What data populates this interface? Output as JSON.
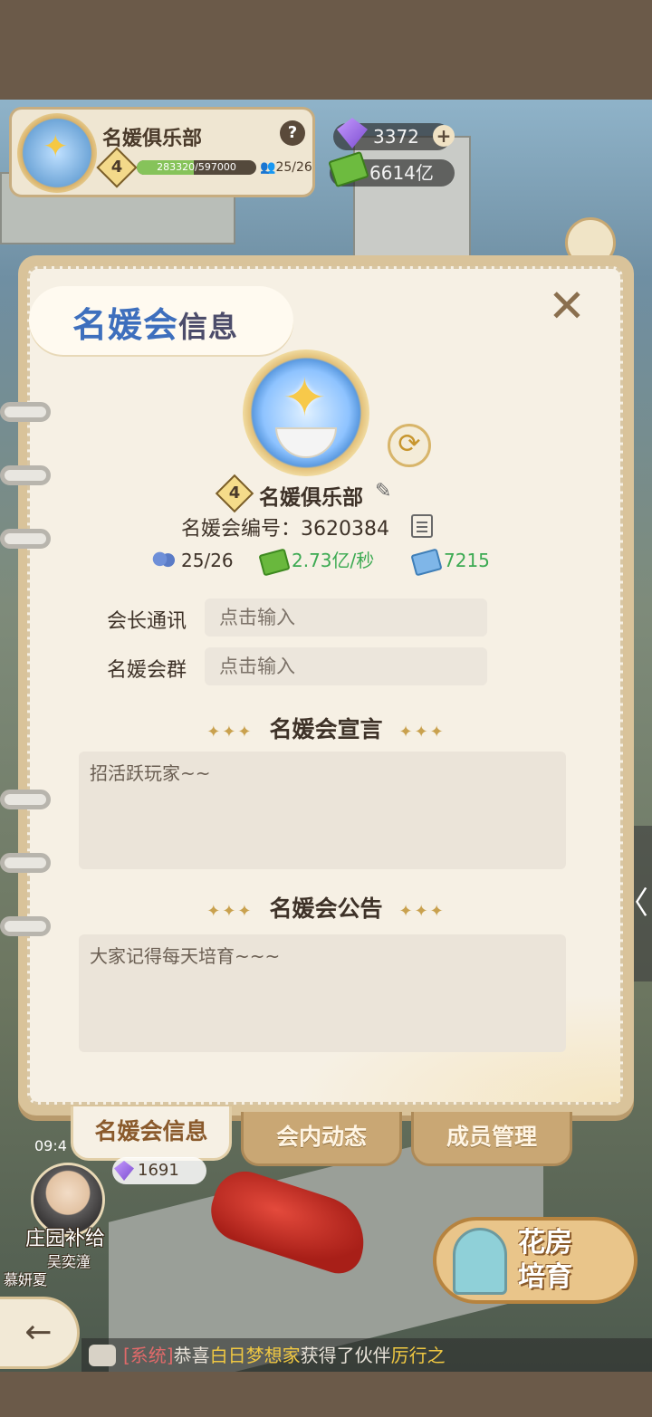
{
  "header": {
    "club_name": "名媛俱乐部",
    "level": "4",
    "exp_text": "283320/597000",
    "exp_fraction": 0.475,
    "members": "25/26",
    "help": "?"
  },
  "currency": {
    "gems": "3372",
    "cash": "6614亿",
    "plus": "+"
  },
  "panel": {
    "title_main": "名媛会",
    "title_suffix": "信息",
    "close": "✕",
    "refresh": "⟳",
    "level": "4",
    "club_name": "名媛俱乐部",
    "edit": "✎",
    "id_label": "名媛会编号：",
    "id_value": "3620384",
    "stats": {
      "members": "25/26",
      "income": "2.73亿/秒",
      "funds": "7215"
    },
    "fields": {
      "president_label": "会长通讯",
      "president_placeholder": "点击输入",
      "group_label": "名媛会群",
      "group_placeholder": "点击输入"
    },
    "declaration": {
      "heading": "名媛会宣言",
      "text": "招活跃玩家~~"
    },
    "announcement": {
      "heading": "名媛会公告",
      "text": "大家记得每天培育~~~"
    },
    "sparkles": "✦✦✦"
  },
  "tabs": [
    "名媛会信息",
    "会内动态",
    "成员管理"
  ],
  "scene": {
    "time": "09:4",
    "gems_small": "1691",
    "avatar_label": "庄园补给",
    "avatar_sub": "吴奕潼",
    "avatar_sub2": "慕妍夏",
    "back": "←",
    "greenhouse_line1": "花房",
    "greenhouse_line2": "培育",
    "side_arrow": "〈"
  },
  "ticker": {
    "system": "[系统]",
    "text1": "恭喜",
    "name1": "白日梦想家",
    "text2": "获得了伙伴",
    "name2": "厉行之"
  }
}
